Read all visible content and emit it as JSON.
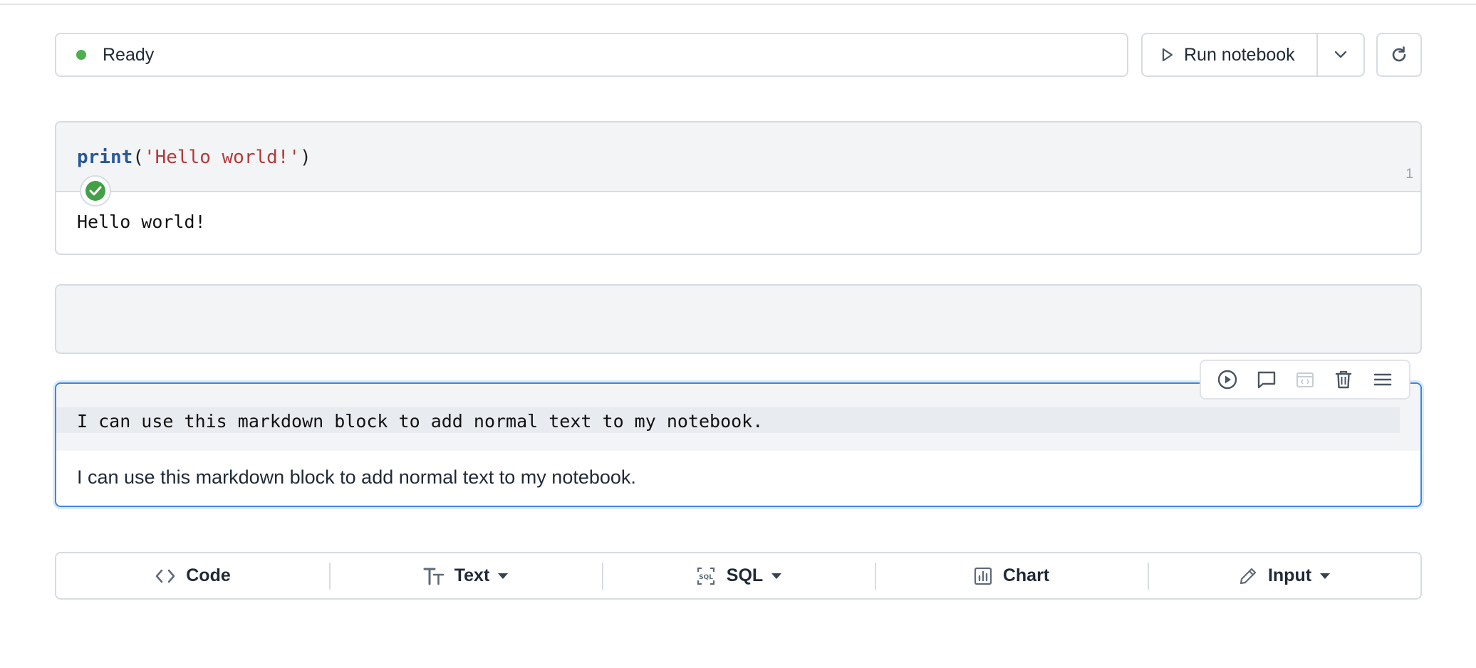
{
  "status": {
    "text": "Ready",
    "dot_color": "#4caf50"
  },
  "toolbar": {
    "run_label": "Run notebook",
    "run_icon": "play-outline-icon",
    "dropdown_icon": "chevron-down-icon",
    "refresh_icon": "refresh-icon"
  },
  "code_cell": {
    "code_fn": "print",
    "code_open": "(",
    "code_str": "'Hello world!'",
    "code_close": ")",
    "line_number": "1",
    "status_icon": "check-circle-icon",
    "output": "Hello world!"
  },
  "markdown_cell": {
    "source": "I can use this markdown block to add normal text to my notebook.",
    "rendered": "I can use this markdown block to add normal text to my notebook."
  },
  "cell_toolbar": {
    "icons": [
      "play-circle-icon",
      "comment-icon",
      "embed-icon",
      "trash-icon",
      "menu-icon"
    ]
  },
  "add_bar": {
    "items": [
      {
        "label": "Code",
        "icon": "code-brackets-icon",
        "has_dropdown": false
      },
      {
        "label": "Text",
        "icon": "text-size-icon",
        "has_dropdown": true
      },
      {
        "label": "SQL",
        "icon": "sql-icon",
        "has_dropdown": true
      },
      {
        "label": "Chart",
        "icon": "bar-chart-icon",
        "has_dropdown": false
      },
      {
        "label": "Input",
        "icon": "pencil-icon",
        "has_dropdown": true
      }
    ]
  },
  "colors": {
    "accent": "#3b87e6",
    "border": "#d7dce3",
    "success": "#43a047",
    "keyword": "#28589a",
    "string": "#b23a3a"
  }
}
